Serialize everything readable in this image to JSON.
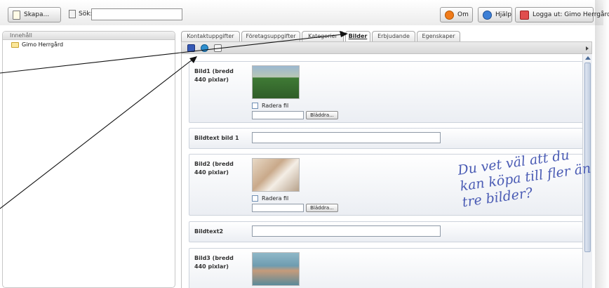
{
  "toolbar": {
    "create_label": "Skapa...",
    "search_label": "Sök:",
    "search_value": "",
    "about_label": "Om",
    "help_label": "Hjälp",
    "logout_label": "Logga ut: Gimo Herrgård"
  },
  "sidebar": {
    "title": "Innehåll",
    "items": [
      {
        "label": "Gimo Herrgård"
      }
    ]
  },
  "tabs": [
    {
      "label": "Kontaktuppgifter",
      "active": false
    },
    {
      "label": "Företagsuppgifter",
      "active": false
    },
    {
      "label": "Kategorier",
      "active": false
    },
    {
      "label": "Bilder",
      "active": true
    },
    {
      "label": "Erbjudande",
      "active": false
    },
    {
      "label": "Egenskaper",
      "active": false
    }
  ],
  "form": {
    "image1_label": "Bild1 (bredd 440 pixlar)",
    "image1_delete": "Radera fil",
    "image1_browse": "Bläddra...",
    "caption1_label": "Bildtext bild 1",
    "caption1_value": "",
    "image2_label": "Bild2 (bredd 440 pixlar)",
    "image2_delete": "Radera fil",
    "image2_browse": "Bläddra...",
    "caption2_label": "Bildtext2",
    "caption2_value": "",
    "image3_label": "Bild3 (bredd 440 pixlar)"
  },
  "annotation": {
    "text": "Du vet väl att du kan köpa till fler än tre bilder?"
  },
  "colors": {
    "annotation_ink": "#4a5bb4",
    "arrow_ink": "#111111",
    "scroll_accent": "#9caec9"
  }
}
